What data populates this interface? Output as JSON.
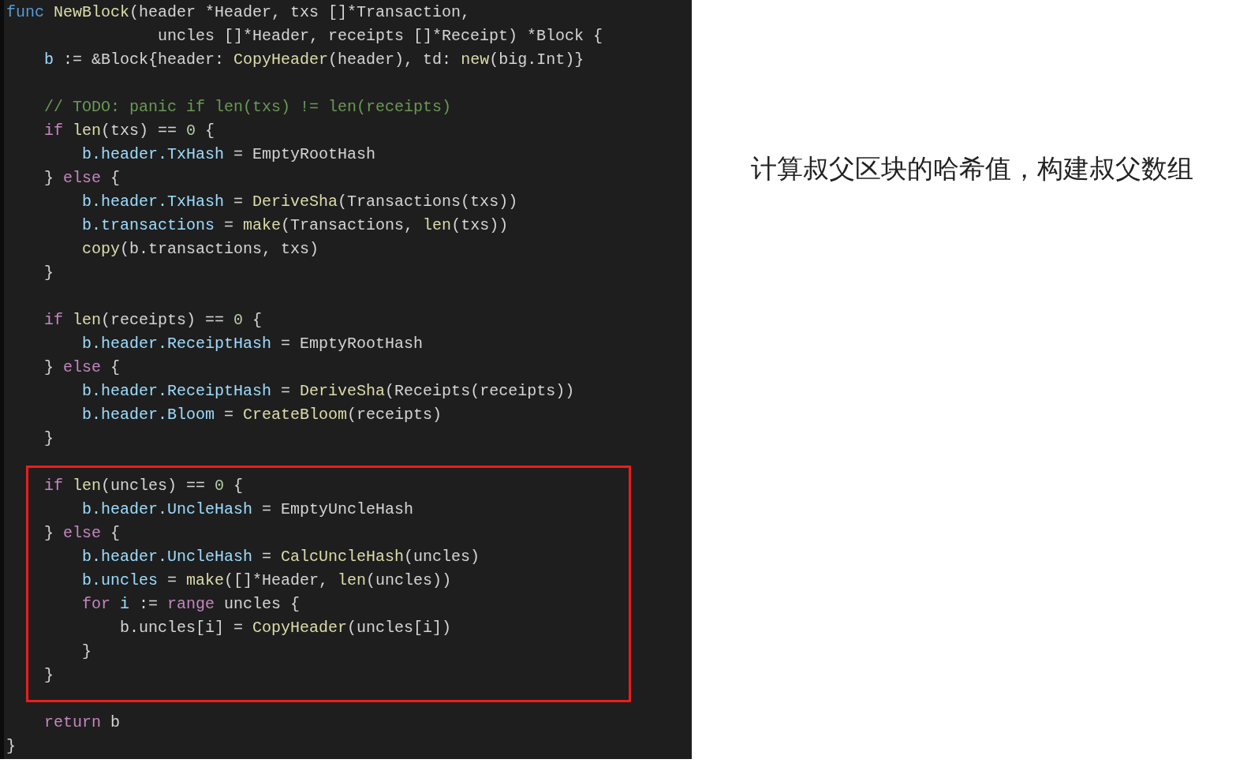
{
  "code": {
    "sections": [
      {
        "highlighted": false,
        "lines": [
          {
            "kind": "code",
            "tokens": [
              {
                "kind": "keyword",
                "text": "func "
              },
              {
                "kind": "function",
                "text": "NewBlock"
              },
              {
                "kind": "plain",
                "text": "(header *Header, txs []*Transaction,"
              }
            ]
          },
          {
            "kind": "code",
            "tokens": [
              {
                "kind": "plain",
                "text": "                uncles []*Header, receipts []*Receipt) *Block {"
              }
            ]
          },
          {
            "kind": "code",
            "tokens": [
              {
                "kind": "variable",
                "text": "    b"
              },
              {
                "kind": "plain",
                "text": " := &Block{header: "
              },
              {
                "kind": "function",
                "text": "CopyHeader"
              },
              {
                "kind": "plain",
                "text": "(header), td: "
              },
              {
                "kind": "function",
                "text": "new"
              },
              {
                "kind": "plain",
                "text": "(big.Int)}"
              }
            ]
          },
          {
            "kind": "blank"
          },
          {
            "kind": "code",
            "tokens": [
              {
                "kind": "comment",
                "text": "    // TODO: panic if len(txs) != len(receipts)"
              }
            ]
          },
          {
            "kind": "code",
            "tokens": [
              {
                "kind": "control",
                "text": "    if "
              },
              {
                "kind": "function",
                "text": "len"
              },
              {
                "kind": "plain",
                "text": "(txs) == "
              },
              {
                "kind": "number",
                "text": "0"
              },
              {
                "kind": "plain",
                "text": " {"
              }
            ]
          },
          {
            "kind": "code",
            "tokens": [
              {
                "kind": "variable",
                "text": "        b.header.TxHash"
              },
              {
                "kind": "plain",
                "text": " = EmptyRootHash"
              }
            ]
          },
          {
            "kind": "code",
            "tokens": [
              {
                "kind": "plain",
                "text": "    } "
              },
              {
                "kind": "control",
                "text": "else"
              },
              {
                "kind": "plain",
                "text": " {"
              }
            ]
          },
          {
            "kind": "code",
            "tokens": [
              {
                "kind": "variable",
                "text": "        b.header.TxHash"
              },
              {
                "kind": "plain",
                "text": " = "
              },
              {
                "kind": "function",
                "text": "DeriveSha"
              },
              {
                "kind": "plain",
                "text": "(Transactions(txs))"
              }
            ]
          },
          {
            "kind": "code",
            "tokens": [
              {
                "kind": "variable",
                "text": "        b.transactions"
              },
              {
                "kind": "plain",
                "text": " = "
              },
              {
                "kind": "function",
                "text": "make"
              },
              {
                "kind": "plain",
                "text": "(Transactions, "
              },
              {
                "kind": "function",
                "text": "len"
              },
              {
                "kind": "plain",
                "text": "(txs))"
              }
            ]
          },
          {
            "kind": "code",
            "tokens": [
              {
                "kind": "function",
                "text": "        copy"
              },
              {
                "kind": "plain",
                "text": "(b.transactions, txs)"
              }
            ]
          },
          {
            "kind": "code",
            "tokens": [
              {
                "kind": "plain",
                "text": "    }"
              }
            ]
          },
          {
            "kind": "blank"
          },
          {
            "kind": "code",
            "tokens": [
              {
                "kind": "control",
                "text": "    if "
              },
              {
                "kind": "function",
                "text": "len"
              },
              {
                "kind": "plain",
                "text": "(receipts) == "
              },
              {
                "kind": "number",
                "text": "0"
              },
              {
                "kind": "plain",
                "text": " {"
              }
            ]
          },
          {
            "kind": "code",
            "tokens": [
              {
                "kind": "variable",
                "text": "        b.header.ReceiptHash"
              },
              {
                "kind": "plain",
                "text": " = EmptyRootHash"
              }
            ]
          },
          {
            "kind": "code",
            "tokens": [
              {
                "kind": "plain",
                "text": "    } "
              },
              {
                "kind": "control",
                "text": "else"
              },
              {
                "kind": "plain",
                "text": " {"
              }
            ]
          },
          {
            "kind": "code",
            "tokens": [
              {
                "kind": "variable",
                "text": "        b.header.ReceiptHash"
              },
              {
                "kind": "plain",
                "text": " = "
              },
              {
                "kind": "function",
                "text": "DeriveSha"
              },
              {
                "kind": "plain",
                "text": "(Receipts(receipts))"
              }
            ]
          },
          {
            "kind": "code",
            "tokens": [
              {
                "kind": "variable",
                "text": "        b.header.Bloom"
              },
              {
                "kind": "plain",
                "text": " = "
              },
              {
                "kind": "function",
                "text": "CreateBloom"
              },
              {
                "kind": "plain",
                "text": "(receipts)"
              }
            ]
          },
          {
            "kind": "code",
            "tokens": [
              {
                "kind": "plain",
                "text": "    }"
              }
            ]
          },
          {
            "kind": "blank"
          }
        ]
      },
      {
        "highlighted": true,
        "lines": [
          {
            "kind": "code",
            "tokens": [
              {
                "kind": "control",
                "text": "    if "
              },
              {
                "kind": "function",
                "text": "len"
              },
              {
                "kind": "plain",
                "text": "(uncles) == "
              },
              {
                "kind": "number",
                "text": "0"
              },
              {
                "kind": "plain",
                "text": " {"
              }
            ]
          },
          {
            "kind": "code",
            "tokens": [
              {
                "kind": "variable",
                "text": "        b.header.UncleHash"
              },
              {
                "kind": "plain",
                "text": " = EmptyUncleHash"
              }
            ]
          },
          {
            "kind": "code",
            "tokens": [
              {
                "kind": "plain",
                "text": "    } "
              },
              {
                "kind": "control",
                "text": "else"
              },
              {
                "kind": "plain",
                "text": " {"
              }
            ]
          },
          {
            "kind": "code",
            "tokens": [
              {
                "kind": "variable",
                "text": "        b.header.UncleHash"
              },
              {
                "kind": "plain",
                "text": " = "
              },
              {
                "kind": "function",
                "text": "CalcUncleHash"
              },
              {
                "kind": "plain",
                "text": "(uncles)"
              }
            ]
          },
          {
            "kind": "code",
            "tokens": [
              {
                "kind": "variable",
                "text": "        b.uncles"
              },
              {
                "kind": "plain",
                "text": " = "
              },
              {
                "kind": "function",
                "text": "make"
              },
              {
                "kind": "plain",
                "text": "([]*Header, "
              },
              {
                "kind": "function",
                "text": "len"
              },
              {
                "kind": "plain",
                "text": "(uncles))"
              }
            ]
          },
          {
            "kind": "code",
            "tokens": [
              {
                "kind": "control",
                "text": "        for "
              },
              {
                "kind": "variable",
                "text": "i"
              },
              {
                "kind": "plain",
                "text": " := "
              },
              {
                "kind": "control",
                "text": "range"
              },
              {
                "kind": "plain",
                "text": " uncles {"
              }
            ]
          },
          {
            "kind": "code",
            "tokens": [
              {
                "kind": "plain",
                "text": "            b.uncles[i] = "
              },
              {
                "kind": "function",
                "text": "CopyHeader"
              },
              {
                "kind": "plain",
                "text": "(uncles[i])"
              }
            ]
          },
          {
            "kind": "code",
            "tokens": [
              {
                "kind": "plain",
                "text": "        }"
              }
            ]
          },
          {
            "kind": "code",
            "tokens": [
              {
                "kind": "plain",
                "text": "    }"
              }
            ]
          }
        ]
      },
      {
        "highlighted": false,
        "lines": [
          {
            "kind": "code",
            "tokens": [
              {
                "kind": "control",
                "text": "    return"
              },
              {
                "kind": "plain",
                "text": " b"
              }
            ]
          },
          {
            "kind": "code",
            "tokens": [
              {
                "kind": "plain",
                "text": "}"
              }
            ]
          }
        ]
      }
    ]
  },
  "caption": "计算叔父区块的哈希值，构建叔父数组"
}
